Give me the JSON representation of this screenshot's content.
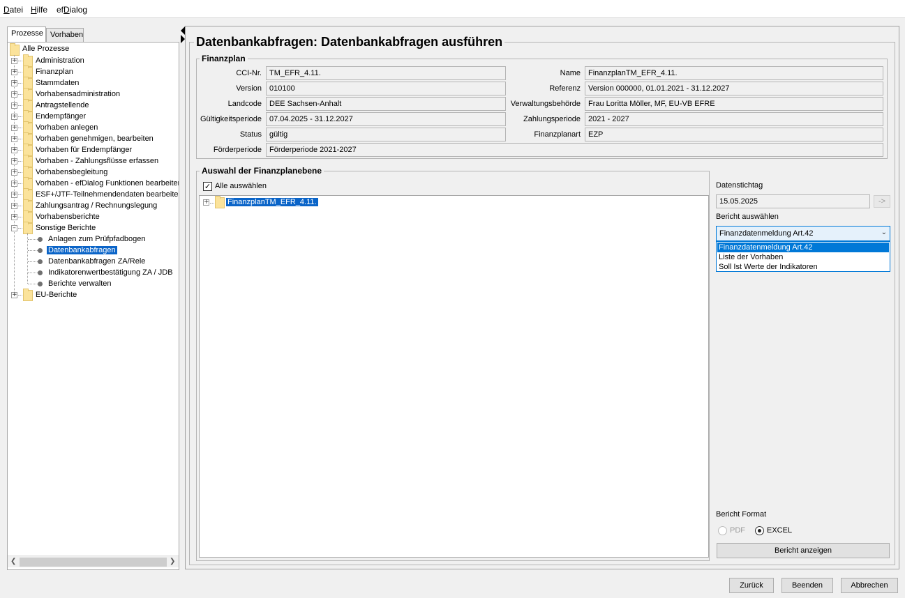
{
  "menu": [
    {
      "label": "Datei"
    },
    {
      "label": "Hilfe"
    },
    {
      "label": "efDialog"
    }
  ],
  "left_tabs": [
    {
      "label": "Prozesse",
      "active": true
    },
    {
      "label": "Vorhaben",
      "active": false
    }
  ],
  "process_tree": {
    "root": "Alle Prozesse",
    "items": [
      "Administration",
      "Finanzplan",
      "Stammdaten",
      "Vorhabensadministration",
      "Antragstellende",
      "Endempfänger",
      "Vorhaben anlegen",
      "Vorhaben genehmigen, bearbeiten",
      "Vorhaben für Endempfänger",
      "Vorhaben - Zahlungsflüsse erfassen",
      "Vorhabensbegleitung",
      "Vorhaben - efDialog Funktionen bearbeiten",
      "ESF+/JTF-Teilnehmendendaten bearbeiten",
      "Zahlungsantrag / Rechnungslegung",
      "Vorhabensberichte",
      "Sonstige Berichte"
    ],
    "sonstige_children": [
      "Anlagen zum Prüfpfadbogen",
      "Datenbankabfragen",
      "Datenbankabfragen ZA/Rele",
      "Indikatorenwertbestätigung ZA / JDB",
      "Berichte verwalten"
    ],
    "selected": "Datenbankabfragen",
    "last_item": "EU-Berichte"
  },
  "page_title": "Datenbankabfragen: Datenbankabfragen ausführen",
  "finanzplan": {
    "title": "Finanzplan",
    "fields_left": [
      {
        "label": "CCI-Nr.",
        "value": "TM_EFR_4.11."
      },
      {
        "label": "Version",
        "value": "010100"
      },
      {
        "label": "Landcode",
        "value": "DEE Sachsen-Anhalt"
      },
      {
        "label": "Gültigkeitsperiode",
        "value": "07.04.2025 - 31.12.2027"
      },
      {
        "label": "Status",
        "value": "gültig"
      }
    ],
    "fields_right": [
      {
        "label": "Name",
        "value": "FinanzplanTM_EFR_4.11."
      },
      {
        "label": "Referenz",
        "value": "Version 000000,  01.01.2021 - 31.12.2027"
      },
      {
        "label": "Verwaltungsbehörde",
        "value": "Frau Loritta Möller,  MF, EU-VB EFRE"
      },
      {
        "label": "Zahlungsperiode",
        "value": "2021 - 2027"
      },
      {
        "label": "Finanzplanart",
        "value": "EZP"
      }
    ],
    "foerderperiode": {
      "label": "Förderperiode",
      "value": "Förderperiode 2021-2027"
    }
  },
  "auswahl": {
    "title": "Auswahl der Finanzplanebene",
    "select_all_label": "Alle auswählen",
    "select_all_checked": true,
    "tree_item": "FinanzplanTM_EFR_4.11."
  },
  "right_panel": {
    "datenstichtag_label": "Datenstichtag",
    "datenstichtag_value": "15.05.2025",
    "arrow_button": "->",
    "bericht_label": "Bericht auswählen",
    "bericht_selected": "Finanzdatenmeldung Art.42",
    "bericht_options": [
      "Finanzdatenmeldung Art.42",
      "Liste der Vorhaben",
      "Soll Ist Werte der Indikatoren"
    ],
    "format_label": "Bericht Format",
    "format_pdf": "PDF",
    "format_excel": "EXCEL",
    "show_button": "Bericht anzeigen"
  },
  "footer_buttons": {
    "back": "Zurück",
    "finish": "Beenden",
    "cancel": "Abbrechen"
  },
  "colors": {
    "selection": "#0a64c8",
    "combo_border": "#0078d7",
    "folder": "#fbe39b"
  }
}
